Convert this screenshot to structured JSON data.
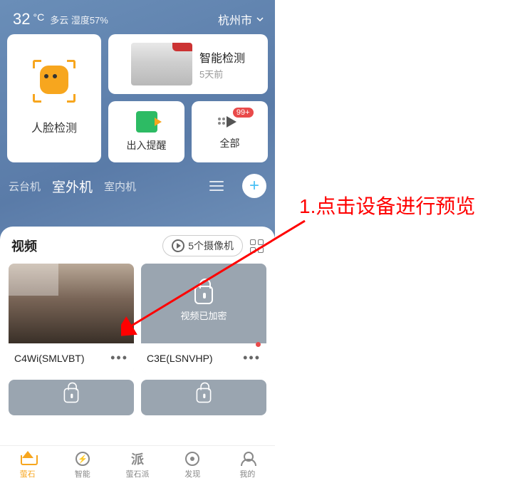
{
  "header": {
    "temperature": "32",
    "unit": "°C",
    "weather": "多云 湿度57%",
    "city": "杭州市"
  },
  "cards": {
    "face_detect": "人脸检测",
    "smart_detect_title": "智能检测",
    "smart_detect_sub": "5天前",
    "exit_remind": "出入提醒",
    "all": "全部",
    "all_badge": "99+"
  },
  "tabs": {
    "t1": "云台机",
    "t2": "室外机",
    "t3": "室内机"
  },
  "sheet": {
    "title": "视频",
    "chip": "5个摄像机",
    "cam1": "C4Wi(SMLVBT)",
    "cam2": "C3E(LSNVHP)",
    "encrypted": "视频已加密"
  },
  "nav": {
    "n1": "萤石",
    "n2": "智能",
    "n3": "萤石派",
    "n4": "发现",
    "n5": "我的",
    "pai_glyph": "派"
  },
  "annotation": {
    "text": "1.点击设备进行预览"
  }
}
